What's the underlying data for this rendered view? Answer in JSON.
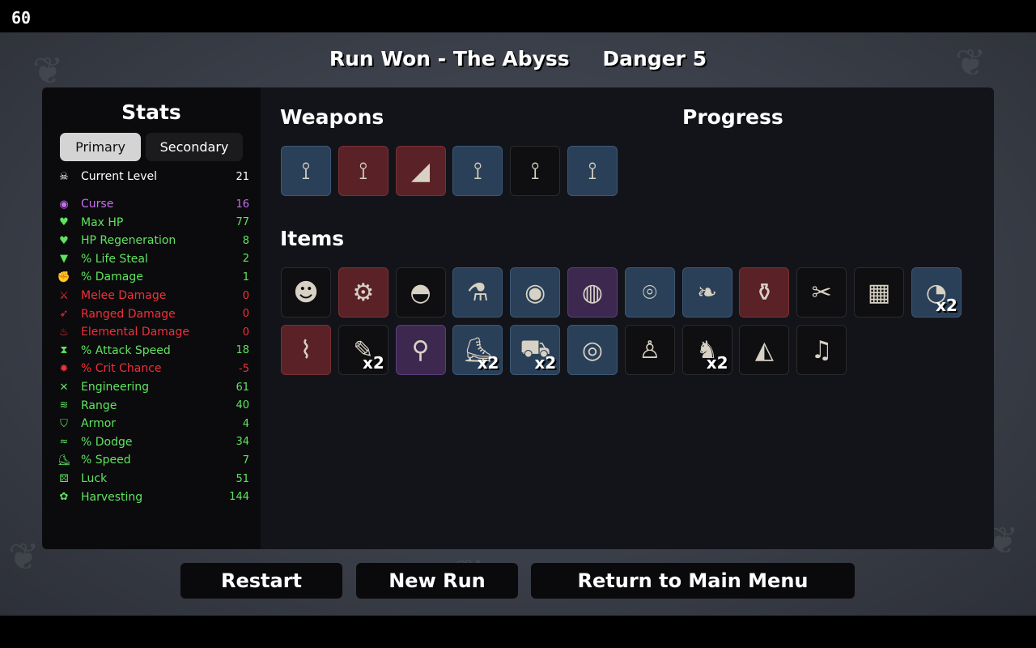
{
  "fps": "60",
  "header": {
    "run_result": "Run Won - The Abyss",
    "danger": "Danger 5"
  },
  "stats_panel": {
    "title": "Stats",
    "tabs": {
      "primary": "Primary",
      "secondary": "Secondary"
    },
    "current_level": {
      "label": "Current Level",
      "value": "21",
      "icon": "skull-level-icon",
      "color": "#ffffff"
    },
    "rows": [
      {
        "label": "Curse",
        "value": "16",
        "color": "#c66ef0",
        "icon": "curse-eye-icon"
      },
      {
        "label": "Max HP",
        "value": "77",
        "color": "#5fe45f",
        "icon": "heart-icon"
      },
      {
        "label": "HP Regeneration",
        "value": "8",
        "color": "#5fe45f",
        "icon": "regen-heart-icon"
      },
      {
        "label": "% Life Steal",
        "value": "2",
        "color": "#5fe45f",
        "icon": "fangs-icon"
      },
      {
        "label": "% Damage",
        "value": "1",
        "color": "#5fe45f",
        "icon": "muscle-icon"
      },
      {
        "label": "Melee Damage",
        "value": "0",
        "color": "#f0303a",
        "icon": "sword-icon"
      },
      {
        "label": "Ranged Damage",
        "value": "0",
        "color": "#f0303a",
        "icon": "bow-icon"
      },
      {
        "label": "Elemental Damage",
        "value": "0",
        "color": "#f0303a",
        "icon": "flame-icon"
      },
      {
        "label": "% Attack Speed",
        "value": "18",
        "color": "#5fe45f",
        "icon": "hourglass-icon"
      },
      {
        "label": "% Crit Chance",
        "value": "-5",
        "color": "#f0303a",
        "icon": "crit-burst-icon"
      },
      {
        "label": "Engineering",
        "value": "61",
        "color": "#5fe45f",
        "icon": "wrench-cross-icon"
      },
      {
        "label": "Range",
        "value": "40",
        "color": "#5fe45f",
        "icon": "range-wave-icon"
      },
      {
        "label": "Armor",
        "value": "4",
        "color": "#5fe45f",
        "icon": "shield-icon"
      },
      {
        "label": "% Dodge",
        "value": "34",
        "color": "#5fe45f",
        "icon": "dodge-wind-icon"
      },
      {
        "label": "% Speed",
        "value": "7",
        "color": "#5fe45f",
        "icon": "boot-icon"
      },
      {
        "label": "Luck",
        "value": "51",
        "color": "#5fe45f",
        "icon": "dice-icon"
      },
      {
        "label": "Harvesting",
        "value": "144",
        "color": "#5fe45f",
        "icon": "wheat-icon"
      }
    ]
  },
  "sections": {
    "weapons": "Weapons",
    "progress": "Progress",
    "items": "Items"
  },
  "weapons": [
    {
      "icon": "slingshot-icon",
      "glyph": "⟟",
      "tier": "blue"
    },
    {
      "icon": "slingshot-icon",
      "glyph": "⟟",
      "tier": "red"
    },
    {
      "icon": "blaster-icon",
      "glyph": "◢",
      "tier": "red"
    },
    {
      "icon": "slingshot-icon",
      "glyph": "⟟",
      "tier": "blue"
    },
    {
      "icon": "slingshot-icon",
      "glyph": "⟟",
      "tier": "black"
    },
    {
      "icon": "slingshot-icon",
      "glyph": "⟟",
      "tier": "blue"
    }
  ],
  "items": [
    {
      "icon": "miner-helmet-icon",
      "glyph": "☻",
      "tier": "black",
      "qty": ""
    },
    {
      "icon": "scrap-robot-icon",
      "glyph": "⚙",
      "tier": "red",
      "qty": ""
    },
    {
      "icon": "helmet-icon",
      "glyph": "◓",
      "tier": "black",
      "qty": ""
    },
    {
      "icon": "potion-flask-icon",
      "glyph": "⚗",
      "tier": "blue",
      "qty": ""
    },
    {
      "icon": "target-ring-icon",
      "glyph": "◉",
      "tier": "blue",
      "qty": ""
    },
    {
      "icon": "pink-pill-icon",
      "glyph": "◍",
      "tier": "purple",
      "qty": ""
    },
    {
      "icon": "spyglass-icon",
      "glyph": "⌾",
      "tier": "blue",
      "qty": ""
    },
    {
      "icon": "leech-icon",
      "glyph": "❧",
      "tier": "blue",
      "qty": ""
    },
    {
      "icon": "blood-vial-icon",
      "glyph": "⚱",
      "tier": "red",
      "qty": ""
    },
    {
      "icon": "voodoo-doll-icon",
      "glyph": "✂",
      "tier": "black",
      "qty": ""
    },
    {
      "icon": "flannel-shirt-icon",
      "glyph": "▦",
      "tier": "black",
      "qty": ""
    },
    {
      "icon": "coin-necklace-icon",
      "glyph": "◔",
      "tier": "blue",
      "qty": "x2"
    },
    {
      "icon": "scroll-icon",
      "glyph": "⌇",
      "tier": "red",
      "qty": ""
    },
    {
      "icon": "pencil-icon",
      "glyph": "✎",
      "tier": "black",
      "qty": "x2"
    },
    {
      "icon": "mortar-pestle-icon",
      "glyph": "⚲",
      "tier": "purple",
      "qty": ""
    },
    {
      "icon": "boot-icon",
      "glyph": "⛸",
      "tier": "blue",
      "qty": "x2"
    },
    {
      "icon": "wheelbarrow-icon",
      "glyph": "⛟",
      "tier": "blue",
      "qty": "x2"
    },
    {
      "icon": "chain-ring-icon",
      "glyph": "◎",
      "tier": "blue",
      "qty": ""
    },
    {
      "icon": "tooth-icon",
      "glyph": "♙",
      "tier": "black",
      "qty": ""
    },
    {
      "icon": "rubber-duck-icon",
      "glyph": "♞",
      "tier": "black",
      "qty": "x2"
    },
    {
      "icon": "cake-slice-icon",
      "glyph": "◭",
      "tier": "black",
      "qty": ""
    },
    {
      "icon": "horn-icon",
      "glyph": "♫",
      "tier": "black",
      "qty": ""
    }
  ],
  "buttons": {
    "restart": "Restart",
    "new_run": "New Run",
    "main_menu": "Return to Main Menu"
  }
}
